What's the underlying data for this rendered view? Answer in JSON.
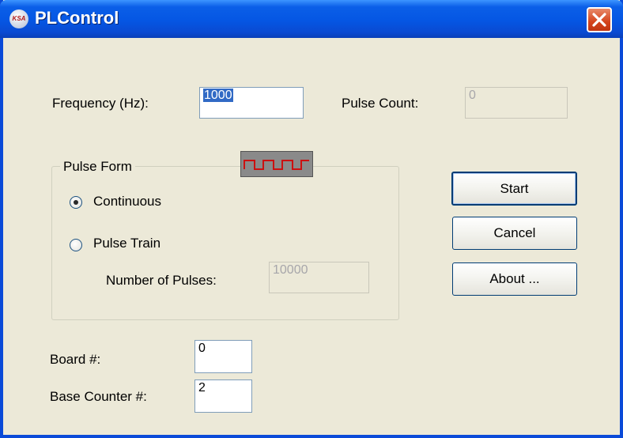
{
  "window": {
    "title": "PLControl",
    "icon_text": "KSA",
    "icon": "app-icon"
  },
  "titlebar": {
    "close_icon": "close-icon"
  },
  "frequency": {
    "label": "Frequency (Hz):",
    "value": "1000"
  },
  "pulse_count": {
    "label": "Pulse Count:",
    "value": "0"
  },
  "pulse_form": {
    "legend": "Pulse Form",
    "wave_icon": "square-wave-icon",
    "continuous_label": "Continuous",
    "continuous_selected": true,
    "pulse_train_label": "Pulse Train",
    "pulse_train_selected": false,
    "num_pulses_label": "Number of Pulses:",
    "num_pulses_value": "10000"
  },
  "buttons": {
    "start": "Start",
    "cancel": "Cancel",
    "about": "About ..."
  },
  "board": {
    "label": "Board #:",
    "value": "0"
  },
  "base_counter": {
    "label": "Base Counter #:",
    "value": "2"
  },
  "colors": {
    "titlebar": "#0556e3",
    "close": "#d4441c",
    "face": "#ece9d8",
    "wave": "#cc1010"
  }
}
